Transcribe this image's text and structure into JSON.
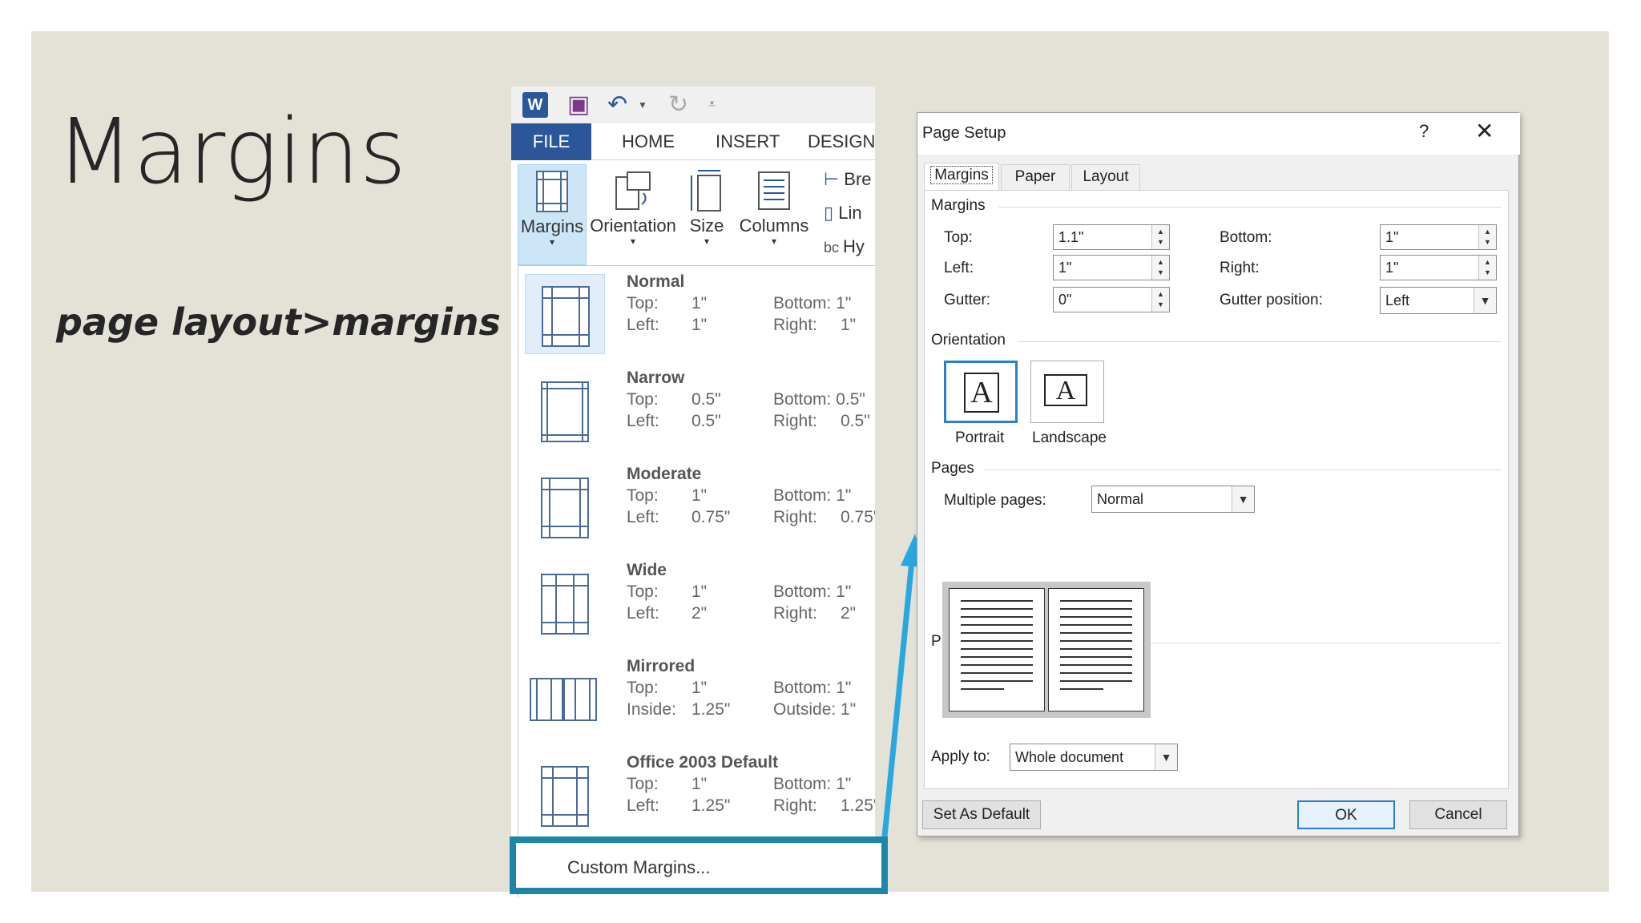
{
  "slide": {
    "title": "Margins",
    "subtitle": "page layout>margins"
  },
  "qat": {
    "word_icon": "word-icon",
    "save_icon": "save-icon",
    "undo_icon": "undo-icon",
    "redo_icon": "redo-icon",
    "customize_icon": "customize-icon"
  },
  "tabs": [
    "FILE",
    "HOME",
    "INSERT",
    "DESIGN"
  ],
  "ribbon": {
    "margins": "Margins",
    "orientation": "Orientation",
    "size": "Size",
    "columns": "Columns",
    "breaks": "Bre",
    "line_numbers": "Lin",
    "hyphenation": "Hy"
  },
  "margin_presets": [
    {
      "name": "Normal",
      "l1": "Top:",
      "v1": "1\"",
      "l2": "Left:",
      "v2": "1\"",
      "r1": "Bottom: 1\"",
      "r2": "Right:",
      "w2": "1\""
    },
    {
      "name": "Narrow",
      "l1": "Top:",
      "v1": "0.5\"",
      "l2": "Left:",
      "v2": "0.5\"",
      "r1": "Bottom: 0.5\"",
      "r2": "Right:",
      "w2": "0.5\""
    },
    {
      "name": "Moderate",
      "l1": "Top:",
      "v1": "1\"",
      "l2": "Left:",
      "v2": "0.75\"",
      "r1": "Bottom: 1\"",
      "r2": "Right:",
      "w2": "0.75\""
    },
    {
      "name": "Wide",
      "l1": "Top:",
      "v1": "1\"",
      "l2": "Left:",
      "v2": "2\"",
      "r1": "Bottom: 1\"",
      "r2": "Right:",
      "w2": "2\""
    },
    {
      "name": "Mirrored",
      "l1": "Top:",
      "v1": "1\"",
      "l2": "Inside:",
      "v2": "1.25\"",
      "r1": "Bottom: 1\"",
      "r2": "Outside: 1\"",
      "w2": ""
    },
    {
      "name": "Office 2003 Default",
      "l1": "Top:",
      "v1": "1\"",
      "l2": "Left:",
      "v2": "1.25\"",
      "r1": "Bottom: 1\"",
      "r2": "Right:",
      "w2": "1.25\""
    }
  ],
  "custom_margins": "Custom Margins...",
  "dialog": {
    "title": "Page Setup",
    "help": "?",
    "close": "✕",
    "tabs": [
      "Margins",
      "Paper",
      "Layout"
    ],
    "margins_section": "Margins",
    "top_label": "Top:",
    "top_value": "1.1\"",
    "left_label": "Left:",
    "left_value": "1\"",
    "gutter_label": "Gutter:",
    "gutter_value": "0\"",
    "bottom_label": "Bottom:",
    "bottom_value": "1\"",
    "right_label": "Right:",
    "right_value": "1\"",
    "gutter_pos_label": "Gutter position:",
    "gutter_pos_value": "Left",
    "orientation_section": "Orientation",
    "portrait": "Portrait",
    "landscape": "Landscape",
    "pages_section": "Pages",
    "multiple_pages_label": "Multiple pages:",
    "multiple_pages_value": "Normal",
    "preview_section": "Preview",
    "apply_to_label": "Apply to:",
    "apply_to_value": "Whole document",
    "set_default": "Set As Default",
    "ok": "OK",
    "cancel": "Cancel"
  },
  "colors": {
    "slide_bg": "#e4e1d6",
    "file_tab": "#2b579a",
    "highlight": "#1b86a8",
    "arrow": "#29a8e0"
  }
}
